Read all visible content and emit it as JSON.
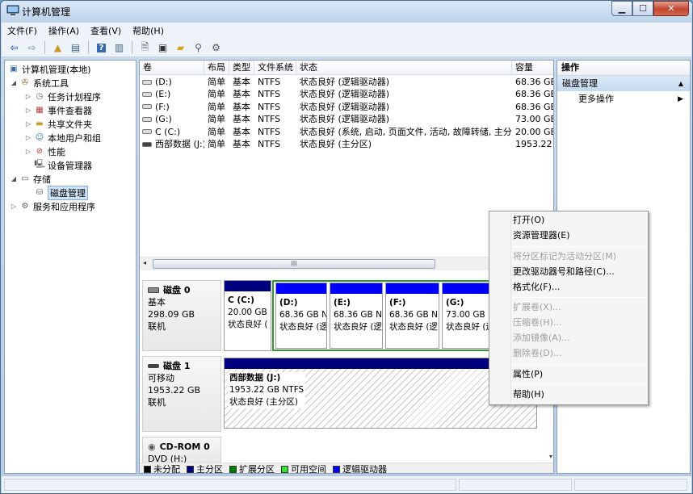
{
  "window": {
    "title": "计算机管理"
  },
  "menubar": [
    "文件(F)",
    "操作(A)",
    "查看(V)",
    "帮助(H)"
  ],
  "tree": {
    "root": "计算机管理(本地)",
    "system_tools": "系统工具",
    "task_scheduler": "任务计划程序",
    "event_viewer": "事件查看器",
    "shared_folders": "共享文件夹",
    "local_users": "本地用户和组",
    "performance": "性能",
    "device_manager": "设备管理器",
    "storage": "存储",
    "disk_management": "磁盘管理",
    "services": "服务和应用程序"
  },
  "volume_table": {
    "columns": [
      "卷",
      "布局",
      "类型",
      "文件系统",
      "状态",
      "容量"
    ],
    "rows": [
      [
        "(D:)",
        "简单",
        "基本",
        "NTFS",
        "状态良好 (逻辑驱动器)",
        "68.36 GB"
      ],
      [
        "(E:)",
        "简单",
        "基本",
        "NTFS",
        "状态良好 (逻辑驱动器)",
        "68.36 GB"
      ],
      [
        "(F:)",
        "简单",
        "基本",
        "NTFS",
        "状态良好 (逻辑驱动器)",
        "68.36 GB"
      ],
      [
        "(G:)",
        "简单",
        "基本",
        "NTFS",
        "状态良好 (逻辑驱动器)",
        "73.00 GB"
      ],
      [
        "C (C:)",
        "简单",
        "基本",
        "NTFS",
        "状态良好 (系统, 启动, 页面文件, 活动, 故障转储, 主分区)",
        "20.00 GB"
      ],
      [
        "西部数据 (J:)",
        "简单",
        "基本",
        "NTFS",
        "状态良好 (主分区)",
        "1953.22 ("
      ]
    ],
    "scroll_grip": "III"
  },
  "disks": {
    "disk0": {
      "name": "磁盘 0",
      "type": "基本",
      "size": "298.09 GB",
      "status": "联机"
    },
    "disk1": {
      "name": "磁盘 1",
      "type": "可移动",
      "size": "1953.22 GB",
      "status": "联机"
    },
    "cdrom0": {
      "name": "CD-ROM 0",
      "type": "DVD (H:)"
    }
  },
  "partitions": {
    "c": {
      "name": "C  (C:)",
      "size": "20.00 GB",
      "status": "状态良好 ("
    },
    "d": {
      "name": "(D:)",
      "size": "68.36 GB N",
      "status": "状态良好 (逻"
    },
    "e": {
      "name": "(E:)",
      "size": "68.36 GB N",
      "status": "状态良好 (逻"
    },
    "f": {
      "name": "(F:)",
      "size": "68.36 GB N",
      "status": "状态良好 (逻"
    },
    "g": {
      "name": "(G:)",
      "size": "73.00 GB N",
      "status": "状态良好 (逻"
    },
    "j": {
      "name": "西部数据  (J:)",
      "size": "1953.22 GB NTFS",
      "status": "状态良好 (主分区)"
    }
  },
  "legend": [
    {
      "label": "未分配",
      "color": "#000000"
    },
    {
      "label": "主分区",
      "color": "#00007f"
    },
    {
      "label": "扩展分区",
      "color": "#008000"
    },
    {
      "label": "可用空间",
      "color": "#33e033"
    },
    {
      "label": "逻辑驱动器",
      "color": "#0000ff"
    }
  ],
  "actions": {
    "header": "操作",
    "section": "磁盘管理",
    "more": "更多操作"
  },
  "context_menu": {
    "open": "打开(O)",
    "explore": "资源管理器(E)",
    "mark_active": "将分区标记为活动分区(M)",
    "change_letter": "更改驱动器号和路径(C)...",
    "format": "格式化(F)...",
    "extend": "扩展卷(X)...",
    "shrink": "压缩卷(H)...",
    "add_mirror": "添加镜像(A)...",
    "delete": "删除卷(D)...",
    "properties": "属性(P)",
    "help": "帮助(H)"
  },
  "colors": {
    "primary_partition": "#00007f",
    "logical_drive": "#0000ff",
    "extended_partition": "#008000",
    "selection": "#cfe3f7"
  }
}
